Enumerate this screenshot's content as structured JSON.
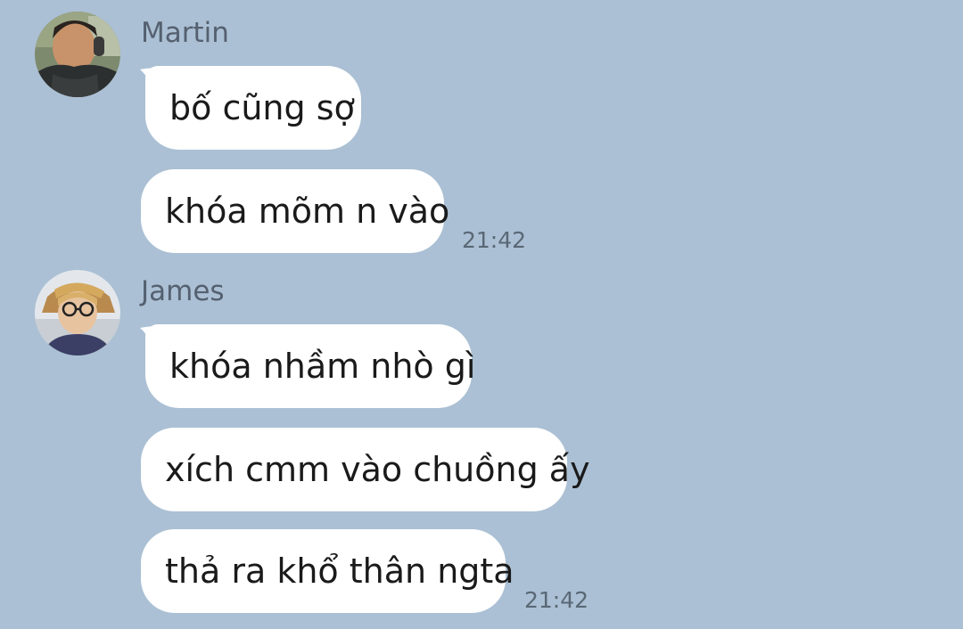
{
  "background_color": "#abc0d4",
  "groups": [
    {
      "sender": "Martin",
      "avatar": "martin-avatar-photo",
      "messages": [
        "bố cũng sợ",
        "khóa mõm n vào"
      ],
      "time": "21:42"
    },
    {
      "sender": "James",
      "avatar": "james-avatar-photo",
      "messages": [
        "khóa nhầm nhò gì",
        "xích cmm vào chuồng ấy",
        "thả ra khổ thân ngta"
      ],
      "time": "21:42"
    }
  ]
}
